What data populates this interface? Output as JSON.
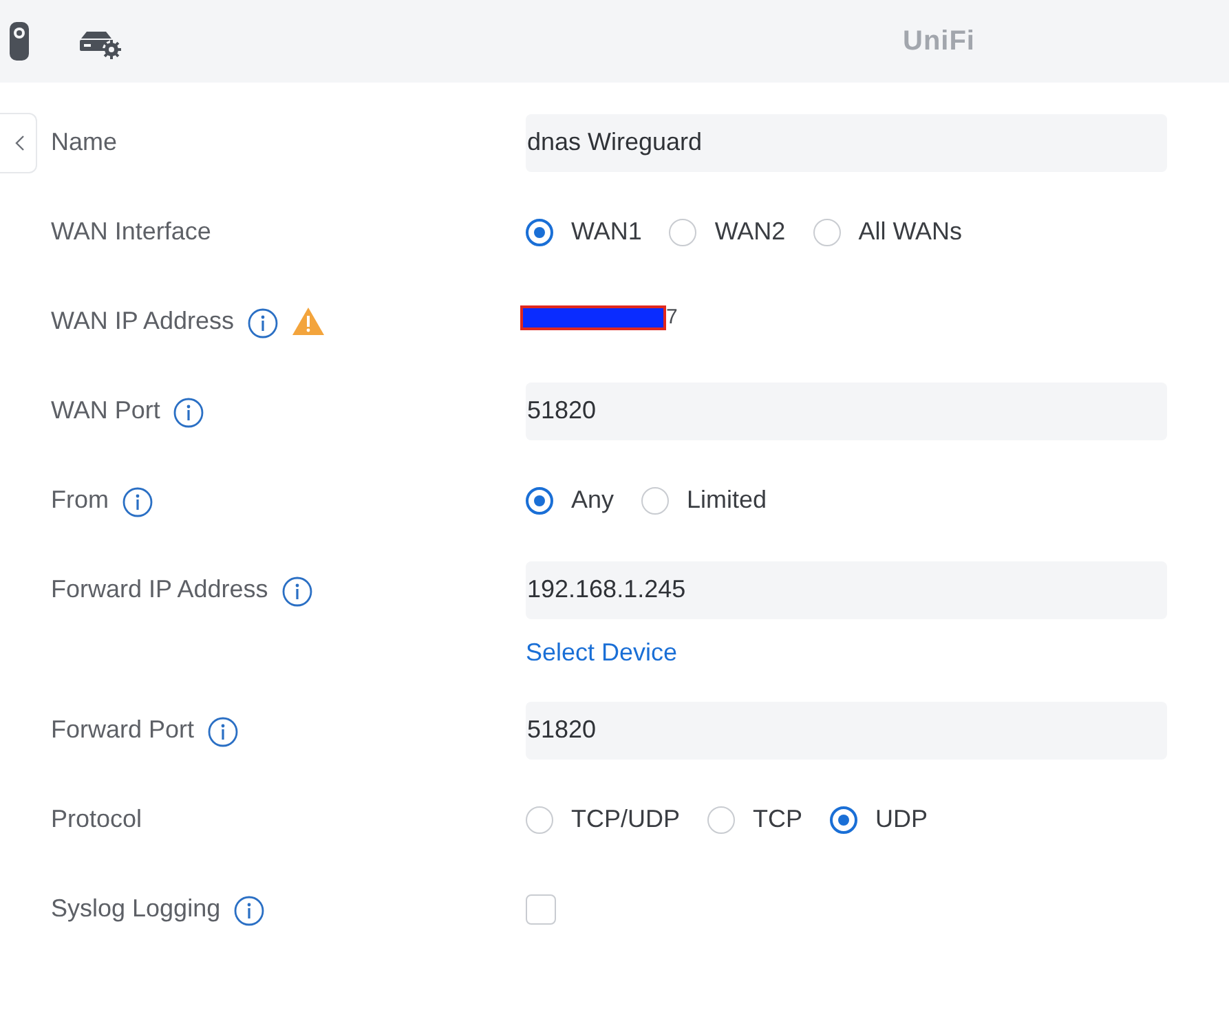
{
  "top_bar": {
    "logo": "UniFi"
  },
  "form": {
    "rows": [
      {
        "kind": "text",
        "label": "Name",
        "info": false,
        "value": "dnas Wireguard"
      },
      {
        "kind": "radio",
        "label": "WAN Interface",
        "info": false,
        "options": [
          {
            "label": "WAN1",
            "selected": true
          },
          {
            "label": "WAN2",
            "selected": false
          },
          {
            "label": "All WANs",
            "selected": false
          }
        ]
      },
      {
        "kind": "readonly",
        "label": "WAN IP Address",
        "info": true,
        "warning": true,
        "redacted": true,
        "value": "7"
      },
      {
        "kind": "text",
        "label": "WAN Port",
        "info": true,
        "value": "51820"
      },
      {
        "kind": "radio",
        "label": "From",
        "info": true,
        "options": [
          {
            "label": "Any",
            "selected": true
          },
          {
            "label": "Limited",
            "selected": false
          }
        ]
      },
      {
        "kind": "text",
        "label": "Forward IP Address",
        "info": true,
        "value": "192.168.1.245",
        "link": "Select Device"
      },
      {
        "kind": "text",
        "label": "Forward Port",
        "info": true,
        "value": "51820"
      },
      {
        "kind": "radio",
        "label": "Protocol",
        "info": false,
        "options": [
          {
            "label": "TCP/UDP",
            "selected": false
          },
          {
            "label": "TCP",
            "selected": false
          },
          {
            "label": "UDP",
            "selected": true
          }
        ]
      },
      {
        "kind": "checkbox",
        "label": "Syslog Logging",
        "info": true,
        "checked": false
      }
    ]
  }
}
